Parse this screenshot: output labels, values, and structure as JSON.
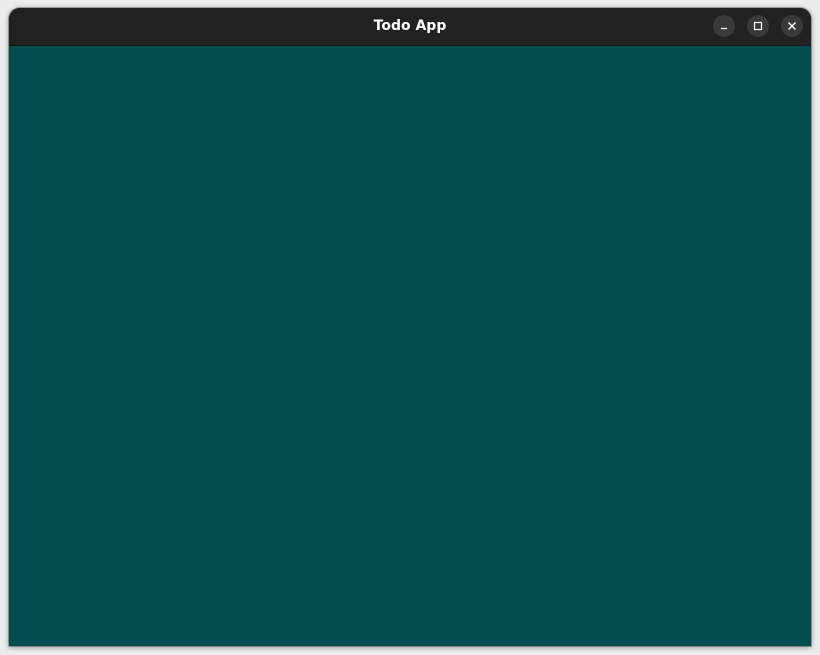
{
  "window": {
    "title": "Todo App",
    "content_color": "#004d4d",
    "titlebar_color": "#222222",
    "controls": [
      {
        "name": "minimize",
        "icon": "minimize-icon"
      },
      {
        "name": "maximize",
        "icon": "maximize-icon"
      },
      {
        "name": "close",
        "icon": "close-icon"
      }
    ]
  }
}
